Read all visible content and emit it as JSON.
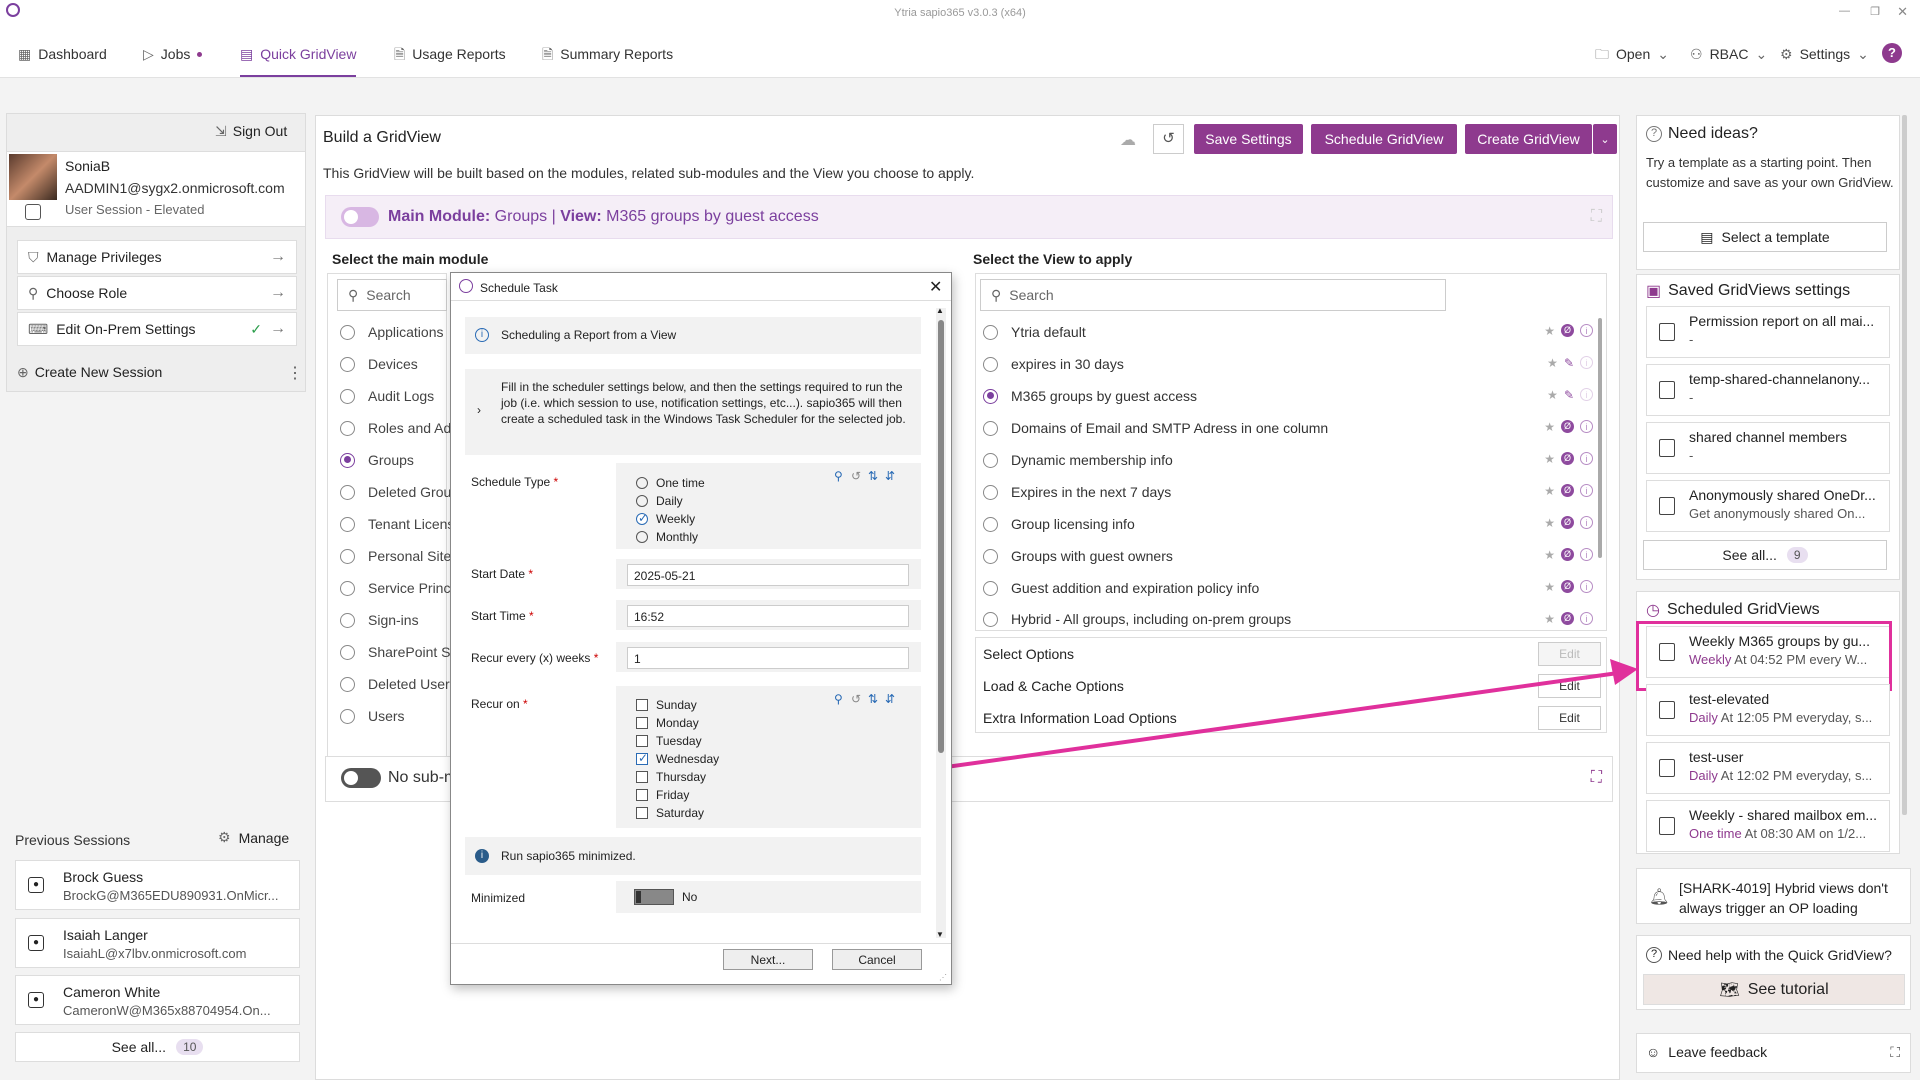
{
  "window": {
    "title": "Ytria sapio365 v3.0.3 (x64)"
  },
  "tabs": [
    {
      "label": "Dashboard",
      "icon": "dashboard-icon"
    },
    {
      "label": "Jobs",
      "icon": "jobs-icon"
    },
    {
      "label": "Quick GridView",
      "icon": "gridview-icon",
      "active": true
    },
    {
      "label": "Usage Reports",
      "icon": "report-icon"
    },
    {
      "label": "Summary Reports",
      "icon": "report-icon"
    }
  ],
  "toolbar_right": {
    "open": "Open",
    "rbac": "RBAC",
    "settings": "Settings",
    "help": "?"
  },
  "session": {
    "sign_out": "Sign Out",
    "user": "SoniaB",
    "email": "AADMIN1@sygx2.onmicrosoft.com",
    "type": "User Session - Elevated",
    "actions": [
      "Manage Privileges",
      "Choose Role",
      "Edit On-Prem Settings"
    ],
    "create_new": "Create New Session"
  },
  "previous_sessions": {
    "title": "Previous Sessions",
    "manage": "Manage",
    "items": [
      {
        "name": "Brock Guess",
        "email": "BrockG@M365EDU890931.OnMicr..."
      },
      {
        "name": "Isaiah Langer",
        "email": "IsaiahL@x7lbv.onmicrosoft.com"
      },
      {
        "name": "Cameron White",
        "email": "CameronW@M365x88704954.On..."
      }
    ],
    "see_all": "See all...",
    "count": "10"
  },
  "builder": {
    "title": "Build a GridView",
    "save_settings": "Save Settings",
    "schedule": "Schedule GridView",
    "create": "Create GridView",
    "subtitle": "This GridView will be built based on the modules, related sub-modules and the View you choose to apply.",
    "main_module_label": "Main Module:",
    "main_module_value": "Groups",
    "view_label": "View:",
    "view_value": "M365 groups by guest access",
    "select_module": "Select the main module",
    "select_view": "Select the View to apply",
    "search_placeholder": "Search",
    "modules": [
      "Applications",
      "Devices",
      "Audit Logs",
      "Roles and Ad",
      "Groups",
      "Deleted Grou",
      "Tenant Licens",
      "Personal Sites",
      "Service Princi",
      "Sign-ins",
      "SharePoint Si",
      "Deleted User",
      "Users"
    ],
    "views": [
      "Ytria default",
      "expires in 30 days",
      "M365 groups by guest access",
      "Domains of Email and SMTP Adress in one column",
      "Dynamic membership info",
      "Expires in the next 7 days",
      "Group licensing info",
      "Groups with guest owners",
      "Guest addition and expiration policy info",
      "Hybrid - All groups, including on-prem groups"
    ],
    "options": [
      "Select Options",
      "Load & Cache Options",
      "Extra Information Load Options"
    ],
    "edit": "Edit",
    "no_sub": "No sub-m"
  },
  "dialog": {
    "title": "Schedule Task",
    "info1": "Scheduling a Report from a View",
    "info2": "Fill in the scheduler settings below, and then the settings required to run the job (i.e. which session to use, notification settings, etc...). sapio365 will then create a scheduled task in the Windows Task Scheduler for the selected job.",
    "schedule_type_label": "Schedule Type",
    "schedule_types": [
      "One time",
      "Daily",
      "Weekly",
      "Monthly"
    ],
    "start_date_label": "Start Date",
    "start_date": "2025-05-21",
    "start_time_label": "Start Time",
    "start_time": "16:52",
    "recur_label": "Recur every (x) weeks",
    "recur": "1",
    "recur_on_label": "Recur on",
    "days": [
      "Sunday",
      "Monday",
      "Tuesday",
      "Wednesday",
      "Thursday",
      "Friday",
      "Saturday"
    ],
    "run_info": "Run sapio365 minimized.",
    "minimized_label": "Minimized",
    "minimized_value": "No",
    "next": "Next...",
    "cancel": "Cancel",
    "required": "*"
  },
  "right": {
    "ideas_title": "Need ideas?",
    "ideas_text": "Try a template as a starting point. Then customize and save as your own GridView.",
    "select_template": "Select a template",
    "saved_title": "Saved GridViews settings",
    "saved": [
      {
        "t1": "Permission report on all mai...",
        "t2": "-"
      },
      {
        "t1": "temp-shared-channelanony...",
        "t2": "-"
      },
      {
        "t1": "shared channel members",
        "t2": "-"
      },
      {
        "t1": "Anonymously shared OneDr...",
        "t2": "Get anonymously shared On..."
      }
    ],
    "see_all": "See all...",
    "saved_count": "9",
    "scheduled_title": "Scheduled GridViews",
    "scheduled": [
      {
        "t1": "Weekly M365 groups by gu...",
        "freq": "Weekly",
        "rest": " At 04:52 PM every W..."
      },
      {
        "t1": "test-elevated",
        "freq": "Daily",
        "rest": " At 12:05 PM everyday, s..."
      },
      {
        "t1": "test-user",
        "freq": "Daily",
        "rest": " At 12:02 PM everyday, s..."
      },
      {
        "t1": "Weekly - shared mailbox em...",
        "freq": "One time",
        "rest": " At 08:30 AM on 1/2..."
      }
    ],
    "news": "[SHARK-4019] Hybrid views don't always trigger an OP loading",
    "help_title": "Need help with the Quick GridView?",
    "tutorial": "See tutorial",
    "feedback": "Leave feedback"
  },
  "colors": {
    "accent": "#8e3a8e",
    "highlight": "#e0309c"
  }
}
